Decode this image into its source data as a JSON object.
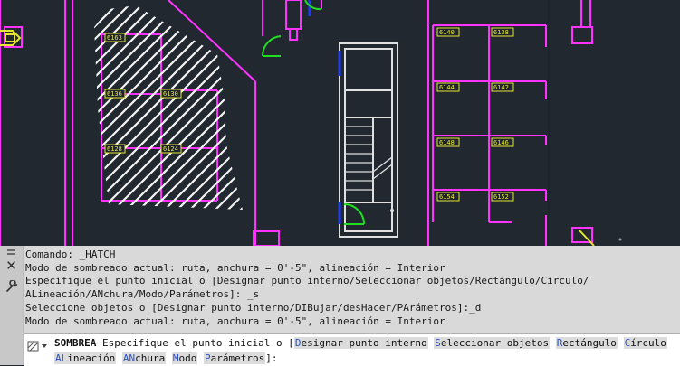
{
  "drawing": {
    "room_labels": [
      "6140",
      "6138",
      "6144",
      "6142",
      "6148",
      "6146",
      "6154",
      "6152",
      "6163",
      "6136",
      "6130",
      "6128",
      "6124",
      "6120"
    ]
  },
  "command_line": {
    "history": [
      "Comando: _HATCH",
      "Modo de sombreado actual: ruta, anchura = 0'-5\", alineación = Interior",
      "Especifique el punto inicial o [Designar punto interno/Seleccionar objetos/Rectángulo/Círculo/",
      "ALineación/ANchura/Modo/Parámetros]: _s",
      "Seleccione objetos o [Designar punto interno/DIBujar/desHacer/PArámetros]:_d",
      "Modo de sombreado actual: ruta, anchura = 0'-5\", alineación = Interior"
    ],
    "prompt": {
      "command": "SOMBREA",
      "text": "Especifique el punto inicial o [",
      "options": [
        {
          "hot": "D",
          "rest": "esignar punto interno"
        },
        {
          "hot": "S",
          "rest": "eleccionar objetos"
        },
        {
          "hot": "R",
          "rest": "ectángulo"
        },
        {
          "hot": "C",
          "rest": "írculo"
        },
        {
          "hot": "AL",
          "rest": "ineación"
        },
        {
          "hot": "AN",
          "rest": "chura"
        },
        {
          "hot": "M",
          "rest": "odo"
        },
        {
          "hot": "P",
          "rest": "arámetros"
        }
      ],
      "end": "]:"
    }
  },
  "icons": {
    "close": "close-icon",
    "customize": "wrench-icon",
    "prompt": "hatch-pattern-icon"
  }
}
